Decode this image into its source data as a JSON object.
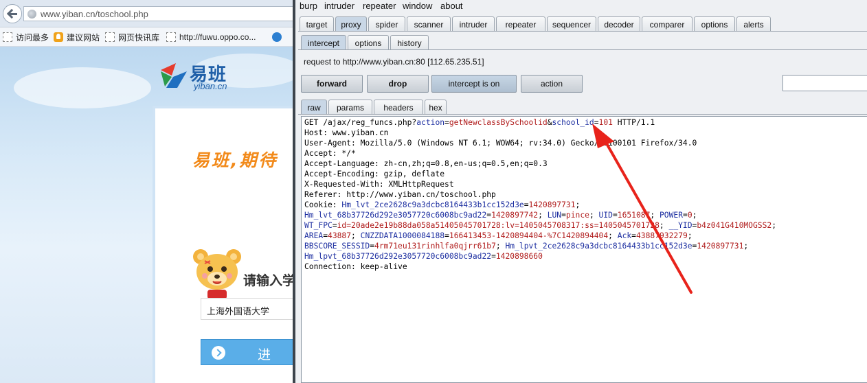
{
  "browser": {
    "url": "www.yiban.cn/toschool.php",
    "bookmarks": [
      {
        "label": "访问最多",
        "icon": "page-icon"
      },
      {
        "label": "建议网站",
        "icon": "bulb-icon"
      },
      {
        "label": "网页快讯库",
        "icon": "page-icon"
      },
      {
        "label": "http://fuwu.oppo.co...",
        "icon": "page-icon"
      }
    ],
    "page": {
      "logo_cn": "易班",
      "logo_en": "yiban.cn",
      "slogan": "易班,期待",
      "prompt": "请输入学",
      "school_value": "上海外国语大学",
      "enter_label": "进"
    }
  },
  "burp": {
    "menu": [
      "burp",
      "intruder",
      "repeater",
      "window",
      "about"
    ],
    "tabs": [
      "target",
      "proxy",
      "spider",
      "scanner",
      "intruder",
      "repeater",
      "sequencer",
      "decoder",
      "comparer",
      "options",
      "alerts"
    ],
    "active_tab": "proxy",
    "proxy_tabs": [
      "intercept",
      "options",
      "history"
    ],
    "active_proxy_tab": "intercept",
    "request_target": "request to http://www.yiban.cn:80  [112.65.235.51]",
    "buttons": {
      "forward": "forward",
      "drop": "drop",
      "intercept": "intercept is on",
      "action": "action"
    },
    "editor_tabs": [
      "raw",
      "params",
      "headers",
      "hex"
    ],
    "active_editor_tab": "raw",
    "request_lines": [
      [
        {
          "t": "GET /ajax/reg_funcs.php?"
        },
        {
          "t": "action",
          "c": "k"
        },
        {
          "t": "="
        },
        {
          "t": "getNewclassBySchoolid",
          "c": "v"
        },
        {
          "t": "&"
        },
        {
          "t": "school_id",
          "c": "k"
        },
        {
          "t": "="
        },
        {
          "t": "101",
          "c": "v"
        },
        {
          "t": " HTTP/1.1"
        }
      ],
      [
        {
          "t": "Host: www.yiban.cn"
        }
      ],
      [
        {
          "t": "User-Agent: Mozilla/5.0 (Windows NT 6.1; WOW64; rv:34.0) Gecko/20100101 Firefox/34.0"
        }
      ],
      [
        {
          "t": "Accept: */*"
        }
      ],
      [
        {
          "t": "Accept-Language: zh-cn,zh;q=0.8,en-us;q=0.5,en;q=0.3"
        }
      ],
      [
        {
          "t": "Accept-Encoding: gzip, deflate"
        }
      ],
      [
        {
          "t": "X-Requested-With: XMLHttpRequest"
        }
      ],
      [
        {
          "t": "Referer: http://www.yiban.cn/toschool.php"
        }
      ],
      [
        {
          "t": "Cookie: "
        },
        {
          "t": "Hm_lvt_2ce2628c9a3dcbc8164433b1cc152d3e",
          "c": "k"
        },
        {
          "t": "="
        },
        {
          "t": "1420897731",
          "c": "v"
        },
        {
          "t": ";"
        }
      ],
      [
        {
          "t": "Hm_lvt_68b37726d292e3057720c6008bc9ad22",
          "c": "k"
        },
        {
          "t": "="
        },
        {
          "t": "1420897742",
          "c": "v"
        },
        {
          "t": "; "
        },
        {
          "t": "LUN",
          "c": "k"
        },
        {
          "t": "="
        },
        {
          "t": "pince",
          "c": "v"
        },
        {
          "t": "; "
        },
        {
          "t": "UID",
          "c": "k"
        },
        {
          "t": "="
        },
        {
          "t": "1651087",
          "c": "v"
        },
        {
          "t": "; "
        },
        {
          "t": "POWER",
          "c": "k"
        },
        {
          "t": "="
        },
        {
          "t": "0",
          "c": "v"
        },
        {
          "t": ";"
        }
      ],
      [
        {
          "t": "WT_FPC",
          "c": "k"
        },
        {
          "t": "="
        },
        {
          "t": "id=20ade2e19b88da058a51405045701728:lv=1405045708317:ss=1405045701728",
          "c": "v"
        },
        {
          "t": "; "
        },
        {
          "t": "__YID",
          "c": "k"
        },
        {
          "t": "="
        },
        {
          "t": "b4z041G410MOGSS2",
          "c": "v"
        },
        {
          "t": ";"
        }
      ],
      [
        {
          "t": "AREA",
          "c": "k"
        },
        {
          "t": "="
        },
        {
          "t": "43887",
          "c": "v"
        },
        {
          "t": "; "
        },
        {
          "t": "CNZZDATA1000084188",
          "c": "k"
        },
        {
          "t": "="
        },
        {
          "t": "166413453-1420894404-%7C1420894404",
          "c": "v"
        },
        {
          "t": "; "
        },
        {
          "t": "Ack",
          "c": "k"
        },
        {
          "t": "="
        },
        {
          "t": "43887932279",
          "c": "v"
        },
        {
          "t": ";"
        }
      ],
      [
        {
          "t": "BBSCORE_SESSID",
          "c": "k"
        },
        {
          "t": "="
        },
        {
          "t": "4rm71eu131rinhlfa0qjrr61b7",
          "c": "v"
        },
        {
          "t": "; "
        },
        {
          "t": "Hm_lpvt_2ce2628c9a3dcbc8164433b1cc152d3e",
          "c": "k"
        },
        {
          "t": "="
        },
        {
          "t": "1420897731",
          "c": "v"
        },
        {
          "t": ";"
        }
      ],
      [
        {
          "t": "Hm_lpvt_68b37726d292e3057720c6008bc9ad22",
          "c": "k"
        },
        {
          "t": "="
        },
        {
          "t": "1420898660",
          "c": "v"
        }
      ],
      [
        {
          "t": "Connection: keep-alive"
        }
      ]
    ]
  },
  "colors": {
    "param_name": "#1c2ea0",
    "param_value": "#b01c1c",
    "arrow": "#e8231b",
    "slogan": "#f28a1a",
    "brand": "#1f5fa8"
  }
}
